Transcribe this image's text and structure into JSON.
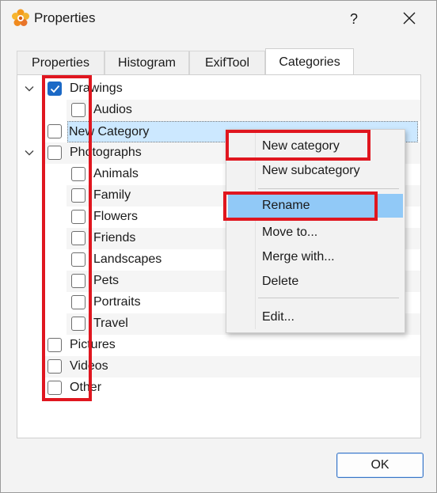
{
  "window": {
    "title": "Properties",
    "help_label": "?",
    "close_icon": "close-icon",
    "app_icon": "xnview-flower-icon"
  },
  "tabs": [
    {
      "label": "Properties",
      "active": false
    },
    {
      "label": "Histogram",
      "active": false
    },
    {
      "label": "ExifTool",
      "active": false
    },
    {
      "label": "Categories",
      "active": true
    }
  ],
  "tree": {
    "items": [
      {
        "label": "Drawings",
        "checked": true,
        "expandable": true,
        "expanded": true,
        "level": 0
      },
      {
        "label": "Audios",
        "checked": false,
        "level": 1
      },
      {
        "label": "New Category",
        "checked": false,
        "level": 0,
        "selected": true
      },
      {
        "label": "Photographs",
        "checked": false,
        "expandable": true,
        "expanded": true,
        "level": 0
      },
      {
        "label": "Animals",
        "checked": false,
        "level": 1
      },
      {
        "label": "Family",
        "checked": false,
        "level": 1
      },
      {
        "label": "Flowers",
        "checked": false,
        "level": 1
      },
      {
        "label": "Friends",
        "checked": false,
        "level": 1
      },
      {
        "label": "Landscapes",
        "checked": false,
        "level": 1
      },
      {
        "label": "Pets",
        "checked": false,
        "level": 1
      },
      {
        "label": "Portraits",
        "checked": false,
        "level": 1
      },
      {
        "label": "Travel",
        "checked": false,
        "level": 1
      },
      {
        "label": "Pictures",
        "checked": false,
        "level": 0
      },
      {
        "label": "Videos",
        "checked": false,
        "level": 0
      },
      {
        "label": "Other",
        "checked": false,
        "level": 0
      }
    ]
  },
  "context_menu": {
    "items": [
      {
        "label": "New category"
      },
      {
        "label": "New subcategory"
      },
      {
        "label": "Rename",
        "hover": true
      },
      {
        "label": "Move to..."
      },
      {
        "label": "Merge with..."
      },
      {
        "label": "Delete"
      },
      {
        "label": "Edit..."
      }
    ]
  },
  "buttons": {
    "ok_label": "OK"
  },
  "colors": {
    "highlight_red": "#e0161f",
    "checkbox_blue": "#1b69c6",
    "selection_bg": "#cce8ff",
    "menu_hover": "#91c9f7"
  }
}
